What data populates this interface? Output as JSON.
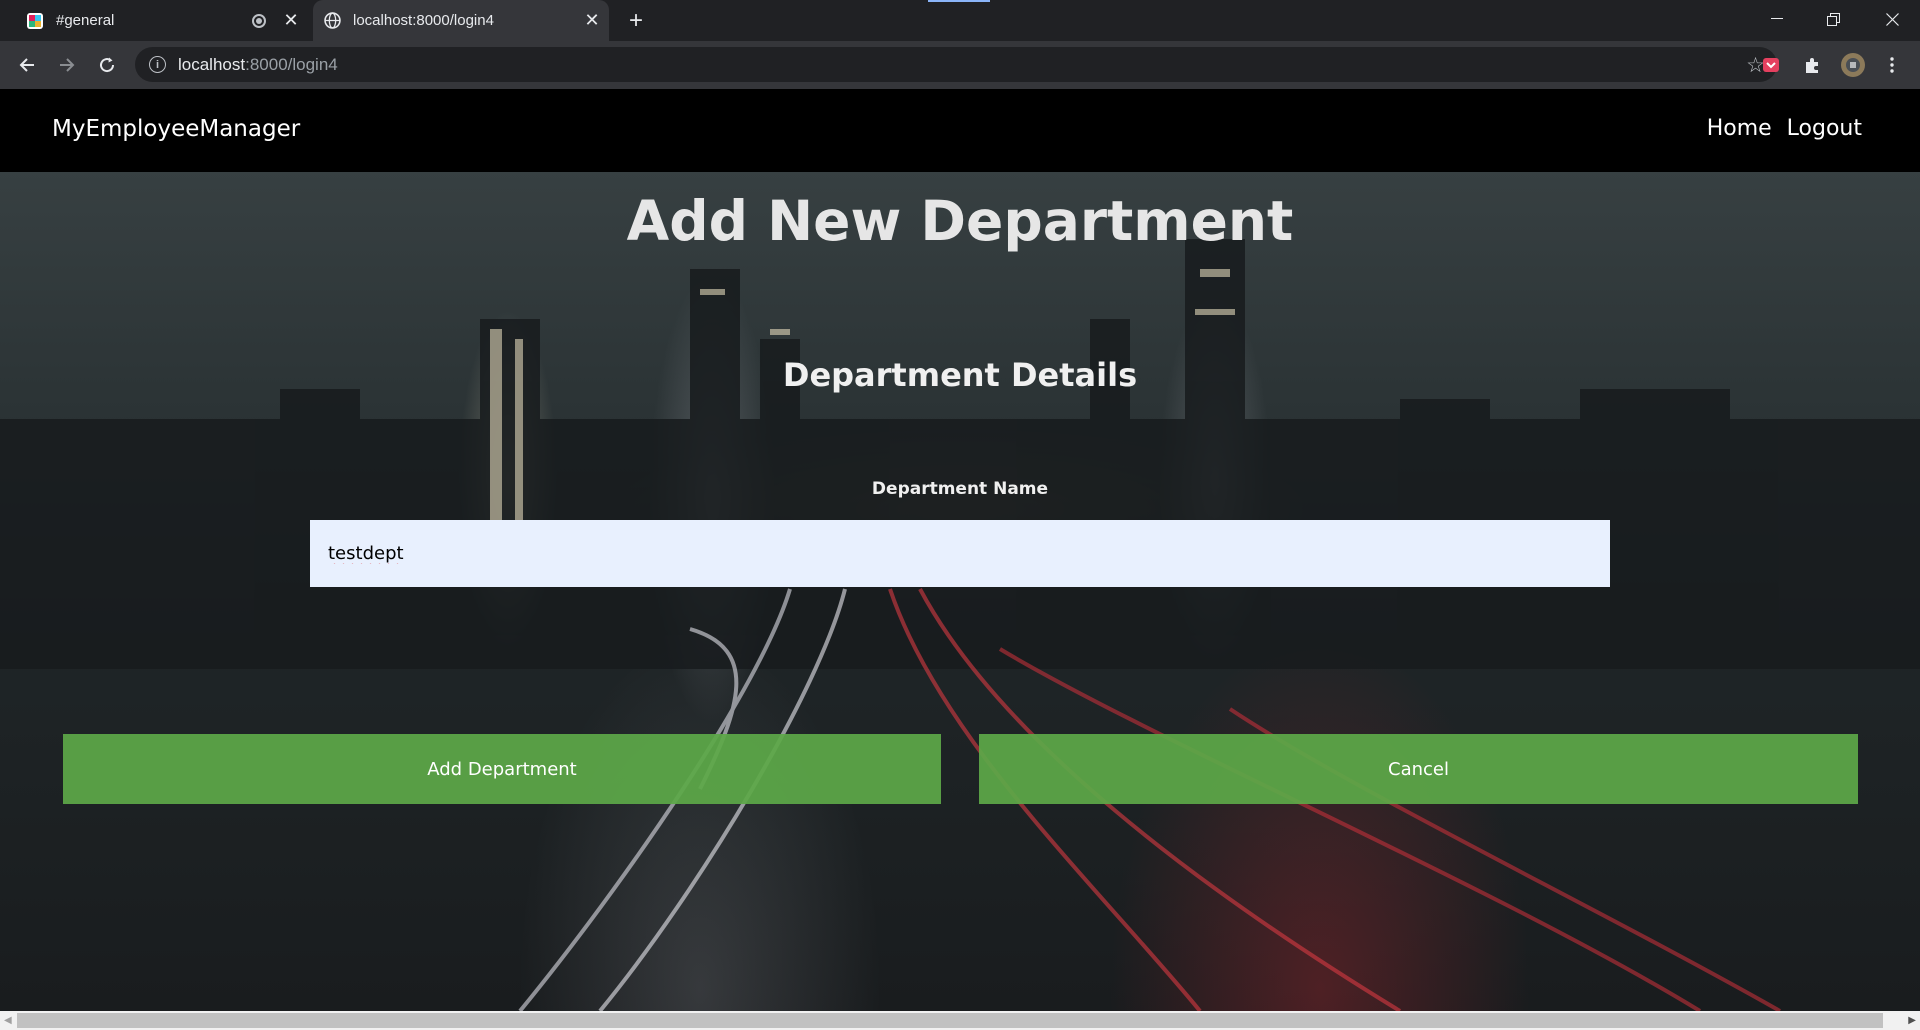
{
  "browser": {
    "tabs": [
      {
        "title": "#general",
        "active": false,
        "icon": "slack-app-icon"
      },
      {
        "title": "localhost:8000/login4",
        "active": true,
        "icon": "globe-icon"
      }
    ],
    "address": {
      "host": "localhost",
      "path": ":8000/login4"
    }
  },
  "navbar": {
    "brand": "MyEmployeeManager",
    "links": [
      "Home",
      "Logout"
    ]
  },
  "page": {
    "title": "Add New Department",
    "section_title": "Department Details",
    "field_label": "Department Name",
    "field_value": "testdept"
  },
  "buttons": {
    "add_label": "Add Department",
    "cancel_label": "Cancel"
  },
  "colors": {
    "button_green": "#5ca848",
    "navbar_bg": "#000000",
    "input_bg": "#e8f0fe"
  }
}
